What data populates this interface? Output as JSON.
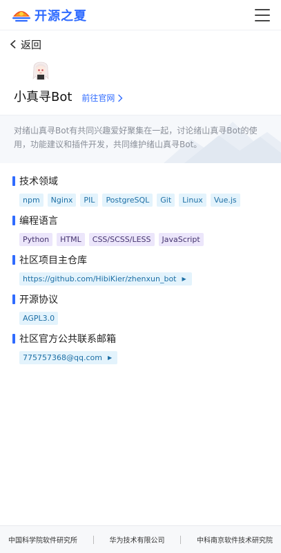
{
  "header": {
    "site_name": "开源之夏",
    "logo_icon": "opensource-summer-logo",
    "menu_icon": "hamburger-menu-icon"
  },
  "nav": {
    "back_label": "返回"
  },
  "project": {
    "name": "小真寻Bot",
    "site_link_label": "前往官网",
    "description": "对绪山真寻Bot有共同兴趣爱好聚集在一起，讨论绪山真寻Bot的使用，功能建议和插件开发，共同维护绪山真寻Bot。"
  },
  "sections": {
    "tech": {
      "title": "技术领域",
      "tags": [
        "npm",
        "Nginx",
        "PIL",
        "PostgreSQL",
        "Git",
        "Linux",
        "Vue.js"
      ]
    },
    "lang": {
      "title": "编程语言",
      "tags": [
        "Python",
        "HTML",
        "CSS/SCSS/LESS",
        "JavaScript"
      ]
    },
    "repo": {
      "title": "社区项目主仓库",
      "url": "https://github.com/HibiKier/zhenxun_bot"
    },
    "license": {
      "title": "开源协议",
      "value": "AGPL3.0"
    },
    "email": {
      "title": "社区官方公共联系邮箱",
      "value": "775757368@qq.com"
    }
  },
  "footer": {
    "orgs": [
      "中国科学院软件研究所",
      "华为技术有限公司",
      "中科南京软件技术研究院"
    ]
  },
  "colors": {
    "accent": "#2f6bff",
    "tag_blue_bg": "#e3f3fc",
    "tag_purple_bg": "#ece6fb"
  }
}
